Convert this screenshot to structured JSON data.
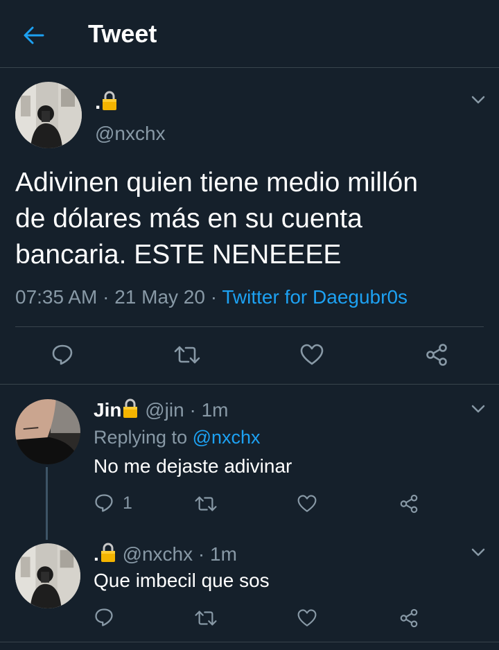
{
  "header": {
    "title": "Tweet"
  },
  "main_tweet": {
    "name": ".",
    "handle": "@nxchx",
    "text_lines": [
      "Adivinen quien tiene medio millón",
      "de dólares más en su cuenta",
      "bancaria. ESTE NENEEEE"
    ],
    "time": "07:35 AM",
    "date": "21 May 20",
    "client": "Twitter for Daegubr0s",
    "separator": " · "
  },
  "replies": [
    {
      "name": "Jin",
      "handle": "@jin",
      "time": "1m",
      "replying_label": "Replying to",
      "replying_to": "@nxchx",
      "text": "No me dejaste adivinar",
      "reply_count": "1"
    },
    {
      "name": ".",
      "handle": "@nxchx",
      "time": "1m",
      "text": "Que imbecil que sos"
    }
  ],
  "icons": {
    "back": "back-arrow-icon",
    "lock": "lock-icon",
    "chevron": "chevron-down-icon",
    "reply": "reply-icon",
    "retweet": "retweet-icon",
    "like": "heart-icon",
    "share": "share-icon"
  },
  "colors": {
    "background": "#15202b",
    "accent": "#1da1f2",
    "secondary_text": "#8899a6",
    "divider": "#38444d"
  }
}
